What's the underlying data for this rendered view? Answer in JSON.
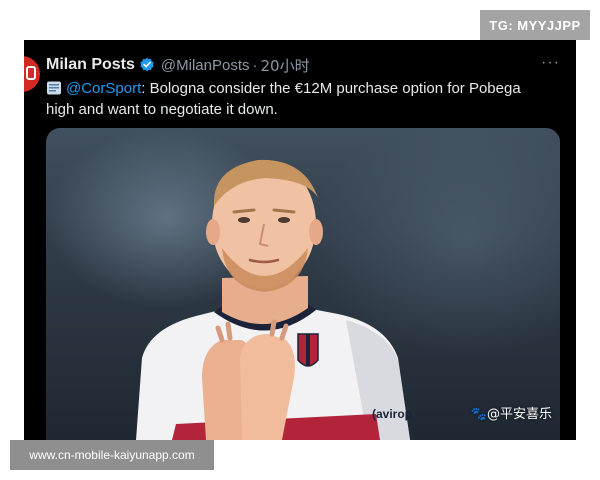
{
  "tweet": {
    "display_name": "Milan Posts",
    "handle": "@MilanPosts",
    "separator": "·",
    "time": "20小时",
    "more": "···",
    "mention": "@CorSport",
    "text": ": Bologna consider the €12M purchase option for Pobega high and want to negotiate it down.",
    "icons": {
      "avatar": "milan-logo",
      "verified": "verified-badge-icon",
      "doc": "page-emoji-icon",
      "more": "more-horizontal-icon"
    }
  },
  "photo": {
    "watermark": "🐾@平安喜乐",
    "shirt_text": "(avirop"
  },
  "overlay": {
    "tg_badge": "TG: MYYJJPP",
    "url_banner": "www.cn-mobile-kaiyunapp.com"
  },
  "colors": {
    "card_bg": "#000000",
    "text": "#e7e9ea",
    "muted": "#8b98a5",
    "link": "#1d9bf0",
    "avatar_red": "#d32a23"
  }
}
